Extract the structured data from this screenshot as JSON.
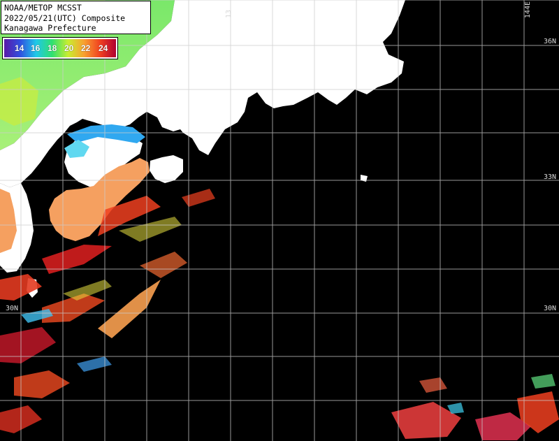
{
  "header": {
    "line1": "NOAA/METOP MCSST",
    "line2": "2022/05/21(UTC) Composite",
    "line3": "Kanagawa Prefecture"
  },
  "legend": {
    "ticks": [
      "14",
      "16",
      "18",
      "20",
      "22",
      "24"
    ],
    "colors": [
      "#5a1aa8",
      "#3050e0",
      "#20c8e8",
      "#30e070",
      "#c8ee30",
      "#f8a030",
      "#f04020",
      "#b00030"
    ]
  },
  "grid_labels": {
    "lat_36_right": "36N",
    "lat_33_right": "33N",
    "lat_30_right": "30N",
    "lat_30_left": "30N",
    "lon_top_right": "144E",
    "lon_top_partial": "13"
  },
  "colors": {
    "land": "#ffffff",
    "ocean_nodata": "#000000",
    "grid": "#cccccc",
    "warm": "#f06020",
    "hot": "#e02020",
    "mild": "#f8a060",
    "cool": "#7ef06a",
    "cold": "#40a0f0"
  }
}
